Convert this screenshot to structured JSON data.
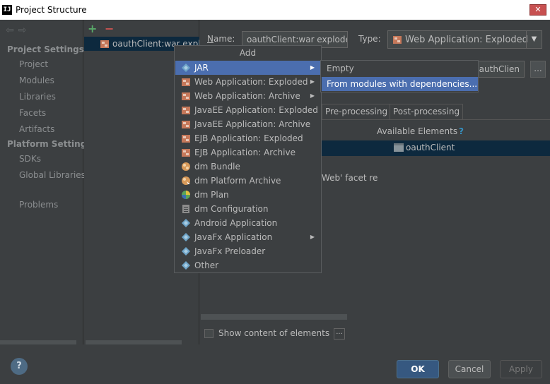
{
  "window": {
    "title": "Project Structure",
    "app_icon_text": "IJ",
    "close_glyph": "✕"
  },
  "nav": {
    "back_forward": "⇦⇨",
    "sections": [
      {
        "label": "Project Settings",
        "items": [
          "Project",
          "Modules",
          "Libraries",
          "Facets",
          "Artifacts"
        ]
      },
      {
        "label": "Platform Settings",
        "items": [
          "SDKs",
          "Global Libraries"
        ]
      }
    ],
    "problems": "Problems"
  },
  "artifacts": {
    "add_glyph": "+",
    "remove_glyph": "−",
    "items": [
      {
        "label": "oauthClient:war exploded"
      }
    ]
  },
  "editor": {
    "name_label_prefix": "N",
    "name_label_rest": "ame:",
    "name_value": "oauthClient:war exploded",
    "type_label": "Type:",
    "type_value": "Web Application: Exploded",
    "output_value": "oauthClien",
    "browse_glyph": "...",
    "tabs": [
      "Pre-processing",
      "Post-processing"
    ],
    "available_elements_label": "Available Elements",
    "help_glyph": "?",
    "available_item": "oauthClient",
    "facet_message": "Web' facet re",
    "show_content_label": "Show content of elements",
    "show_content_btn": "..."
  },
  "popup": {
    "header": "Add",
    "items": [
      {
        "label": "JAR",
        "icon": "jar-icon",
        "submenu": true,
        "selected": true
      },
      {
        "label": "Web Application: Exploded",
        "icon": "web-app-icon",
        "submenu": true
      },
      {
        "label": "Web Application: Archive",
        "icon": "web-app-icon",
        "submenu": true
      },
      {
        "label": "JavaEE Application: Exploded",
        "icon": "javaee-icon",
        "submenu": false
      },
      {
        "label": "JavaEE Application: Archive",
        "icon": "javaee-icon",
        "submenu": false
      },
      {
        "label": "EJB Application: Exploded",
        "icon": "ejb-icon",
        "submenu": false
      },
      {
        "label": "EJB Application: Archive",
        "icon": "ejb-icon",
        "submenu": false
      },
      {
        "label": "dm Bundle",
        "icon": "dm-bundle-icon",
        "submenu": false
      },
      {
        "label": "dm Platform Archive",
        "icon": "dm-platform-icon",
        "submenu": false
      },
      {
        "label": "dm Plan",
        "icon": "dm-plan-icon",
        "submenu": false
      },
      {
        "label": "dm Configuration",
        "icon": "dm-config-icon",
        "submenu": false
      },
      {
        "label": "Android Application",
        "icon": "android-icon",
        "submenu": false
      },
      {
        "label": "JavaFx Application",
        "icon": "javafx-icon",
        "submenu": true
      },
      {
        "label": "JavaFx Preloader",
        "icon": "javafx-icon",
        "submenu": false
      },
      {
        "label": "Other",
        "icon": "other-icon",
        "submenu": false
      }
    ],
    "submenu_arrow": "▶"
  },
  "jar_submenu": {
    "items": [
      {
        "label": "Empty",
        "selected": false
      },
      {
        "label": "From modules with dependencies...",
        "selected": true
      }
    ]
  },
  "footer": {
    "help": "?",
    "ok": "OK",
    "cancel": "Cancel",
    "apply": "Apply"
  },
  "colors": {
    "selection": "#4b6eaf",
    "list_selection": "#0d293e",
    "background": "#3c3f41",
    "ok_button": "#365880"
  }
}
